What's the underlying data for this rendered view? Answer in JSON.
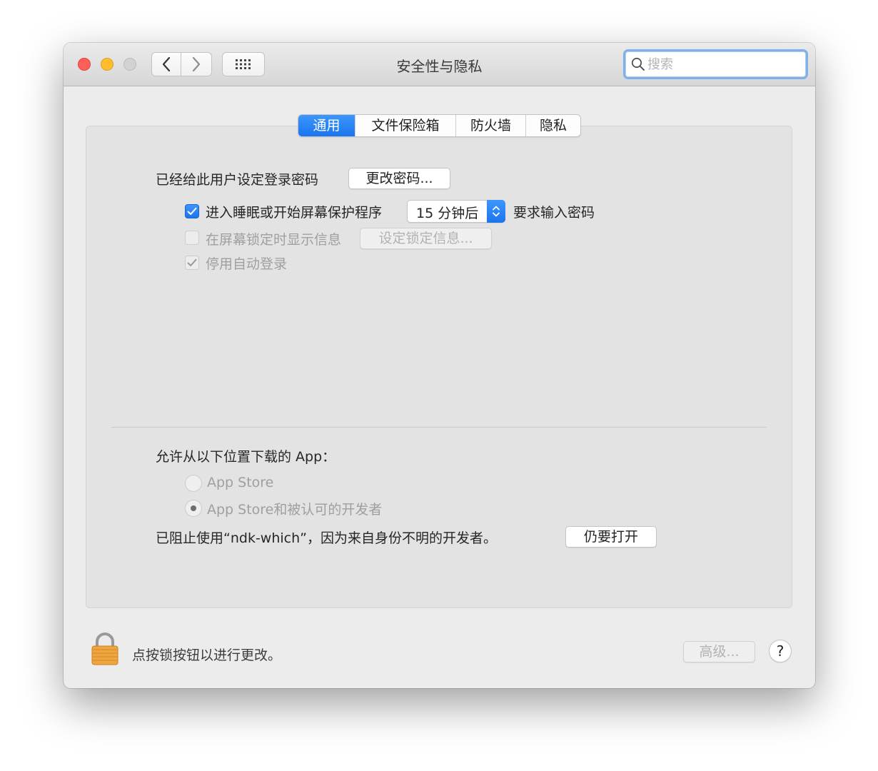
{
  "window": {
    "title": "安全性与隐私",
    "search_placeholder": "搜索"
  },
  "tabs": [
    {
      "label": "通用",
      "active": true
    },
    {
      "label": "文件保险箱",
      "active": false
    },
    {
      "label": "防火墙",
      "active": false
    },
    {
      "label": "隐私",
      "active": false
    }
  ],
  "general": {
    "password_set_label": "已经给此用户设定登录密码",
    "change_password_button": "更改密码...",
    "require_password_checkbox": {
      "label": "进入睡眠或开始屏幕保护程序",
      "checked": true
    },
    "require_password_delay": "15 分钟后",
    "require_password_suffix": "要求输入密码",
    "lock_message_checkbox": {
      "label": "在屏幕锁定时显示信息",
      "checked": false
    },
    "set_lock_message_button": "设定锁定信息...",
    "disable_auto_login_checkbox": {
      "label": "停用自动登录",
      "checked": true
    }
  },
  "downloads": {
    "heading": "允许从以下位置下载的 App：",
    "options": [
      {
        "label": "App Store",
        "selected": false
      },
      {
        "label": "App Store和被认可的开发者",
        "selected": true
      }
    ],
    "blocked_message": "已阻止使用“ndk-which”，因为来自身份不明的开发者。",
    "open_anyway_button": "仍要打开"
  },
  "footer": {
    "lock_message": "点按锁按钮以进行更改。",
    "advanced_button": "高级...",
    "help_button": "?"
  },
  "colors": {
    "accent": "#1a75ef",
    "close": "#fe5f57",
    "minimize": "#febc2e",
    "zoom_disabled": "#d2d2d2",
    "lock_gold": "#f0a640"
  }
}
